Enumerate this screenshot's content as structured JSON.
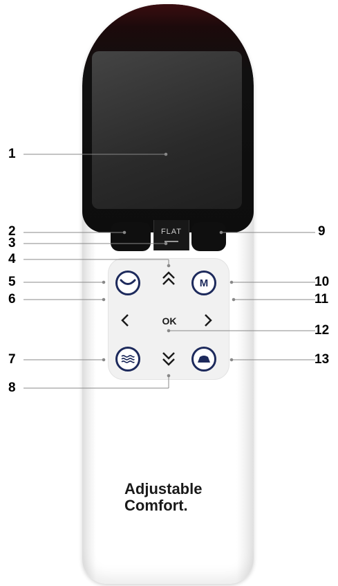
{
  "callouts": {
    "c1": "1",
    "c2": "2",
    "c3": "3",
    "c4": "4",
    "c5": "5",
    "c6": "6",
    "c7": "7",
    "c8": "8",
    "c9": "9",
    "c10": "10",
    "c11": "11",
    "c12": "12",
    "c13": "13"
  },
  "remote": {
    "flat_label": "FLAT",
    "ok_label": "OK",
    "memory_label": "M",
    "brand_line1": "Adjustable",
    "brand_line2": "Comfort."
  },
  "colors": {
    "button_ring": "#1d2a5c",
    "remote_top": "#101010",
    "remote_body": "#ffffff"
  },
  "icons": [
    "up-chevrons-icon",
    "down-chevrons-icon",
    "left-arrow-icon",
    "right-arrow-icon",
    "zero-gravity-icon",
    "massage-waves-icon",
    "anti-snore-icon"
  ]
}
